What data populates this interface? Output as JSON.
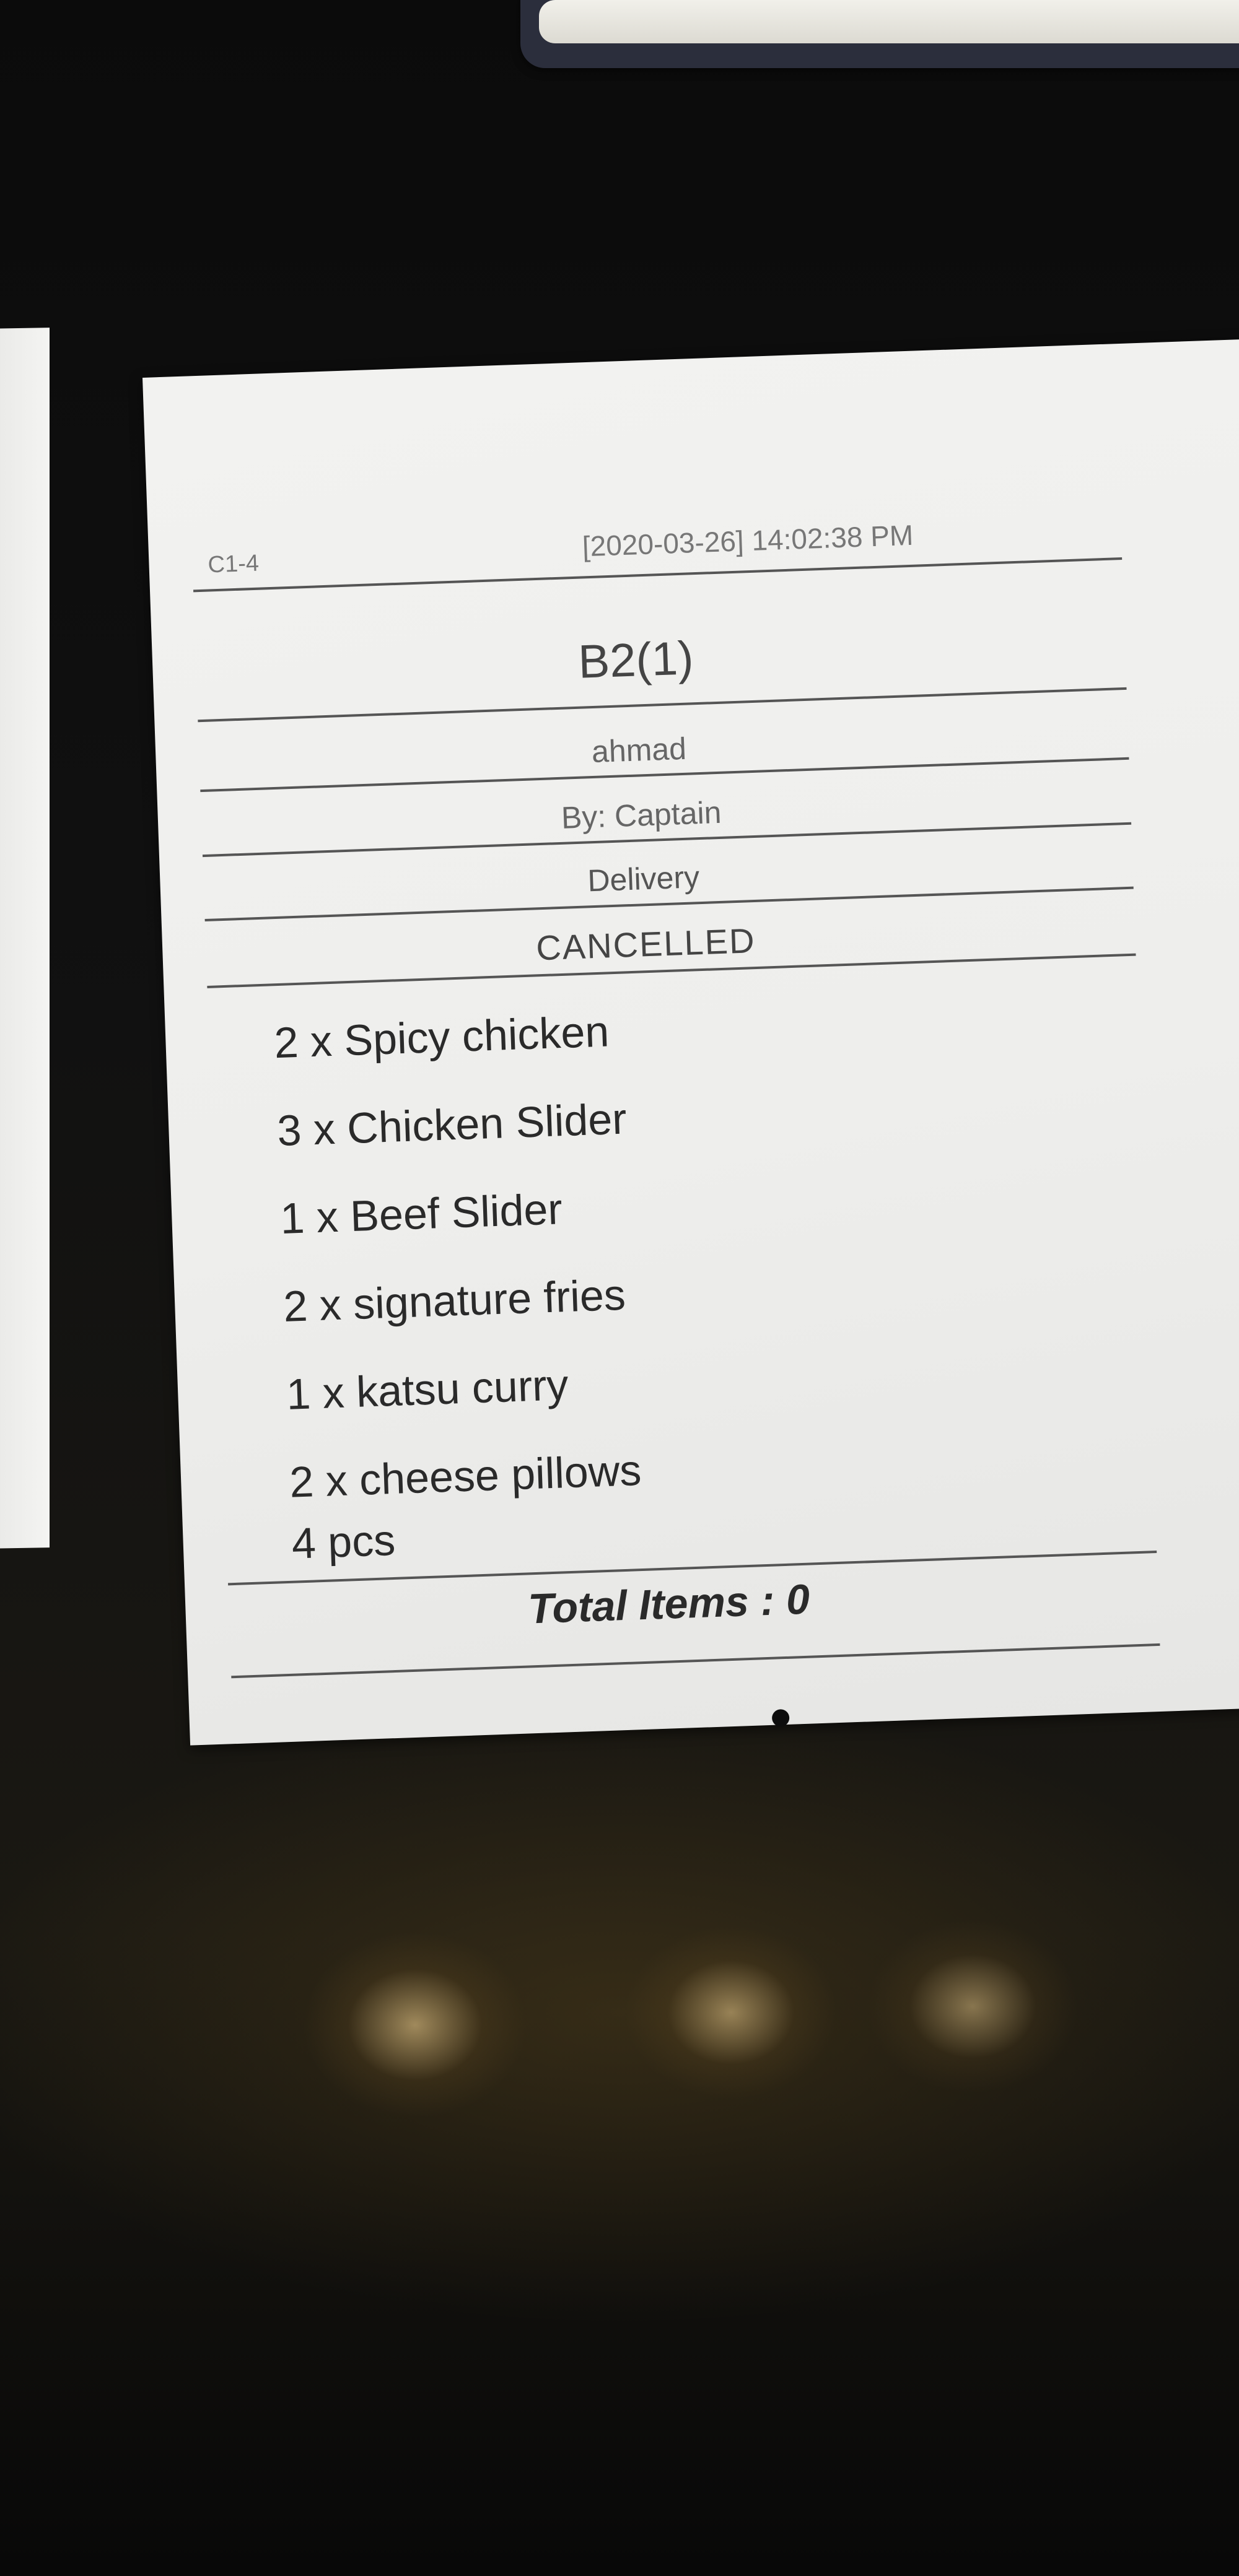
{
  "receipt": {
    "station_code": "C1-4",
    "timestamp": "[2020-03-26] 14:02:38 PM",
    "table": "B2(1)",
    "customer": "ahmad",
    "placed_by": "By: Captain",
    "order_type": "Delivery",
    "status": "CANCELLED",
    "items": [
      "2 x Spicy chicken",
      "3 x Chicken Slider",
      "1 x Beef Slider",
      "2 x signature fries",
      "1 x katsu curry",
      "2 x cheese pillows"
    ],
    "item_note": "4 pcs",
    "total": "Total Items : 0"
  },
  "colors": {
    "paper": "#eeeeec",
    "ink": "#2a2a2a",
    "table": "#0a0a0a",
    "phone_frame": "#2b2e3c"
  }
}
